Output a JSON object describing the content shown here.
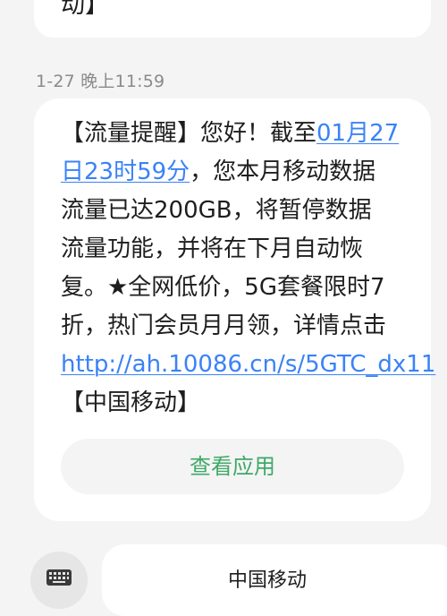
{
  "previous_message": {
    "tail_text": "动】"
  },
  "message": {
    "timestamp": "1-27 晚上11:59",
    "lines": [
      {
        "pre": "【流量提醒】您好！截至",
        "link": "01月27",
        "post": ""
      },
      {
        "pre": "",
        "link": "日23时59分",
        "post": "，您本月移动数据"
      },
      {
        "pre": "流量已达200GB，将暂停数据",
        "link": "",
        "post": ""
      },
      {
        "pre": "流量功能，并将在下月自动恢",
        "link": "",
        "post": ""
      },
      {
        "pre": "复。★全网低价，5G套餐限时7",
        "link": "",
        "post": ""
      },
      {
        "pre": "折，热门会员月月领，详情点击",
        "link": "",
        "post": ""
      },
      {
        "pre": "",
        "link": "http://ah.10086.cn/s/5GTC_dx11",
        "post": ""
      },
      {
        "pre": "【中国移动】",
        "link": "",
        "post": ""
      }
    ],
    "action_button_label": "查看应用"
  },
  "bottom_bar": {
    "keyboard_icon": "keyboard-icon",
    "menu_item_label": "中国移动"
  },
  "colors": {
    "background": "#f4f4f4",
    "bubble": "#ffffff",
    "link": "#3a82f7",
    "action_text": "#3fa969",
    "timestamp": "#8a8a8a"
  }
}
